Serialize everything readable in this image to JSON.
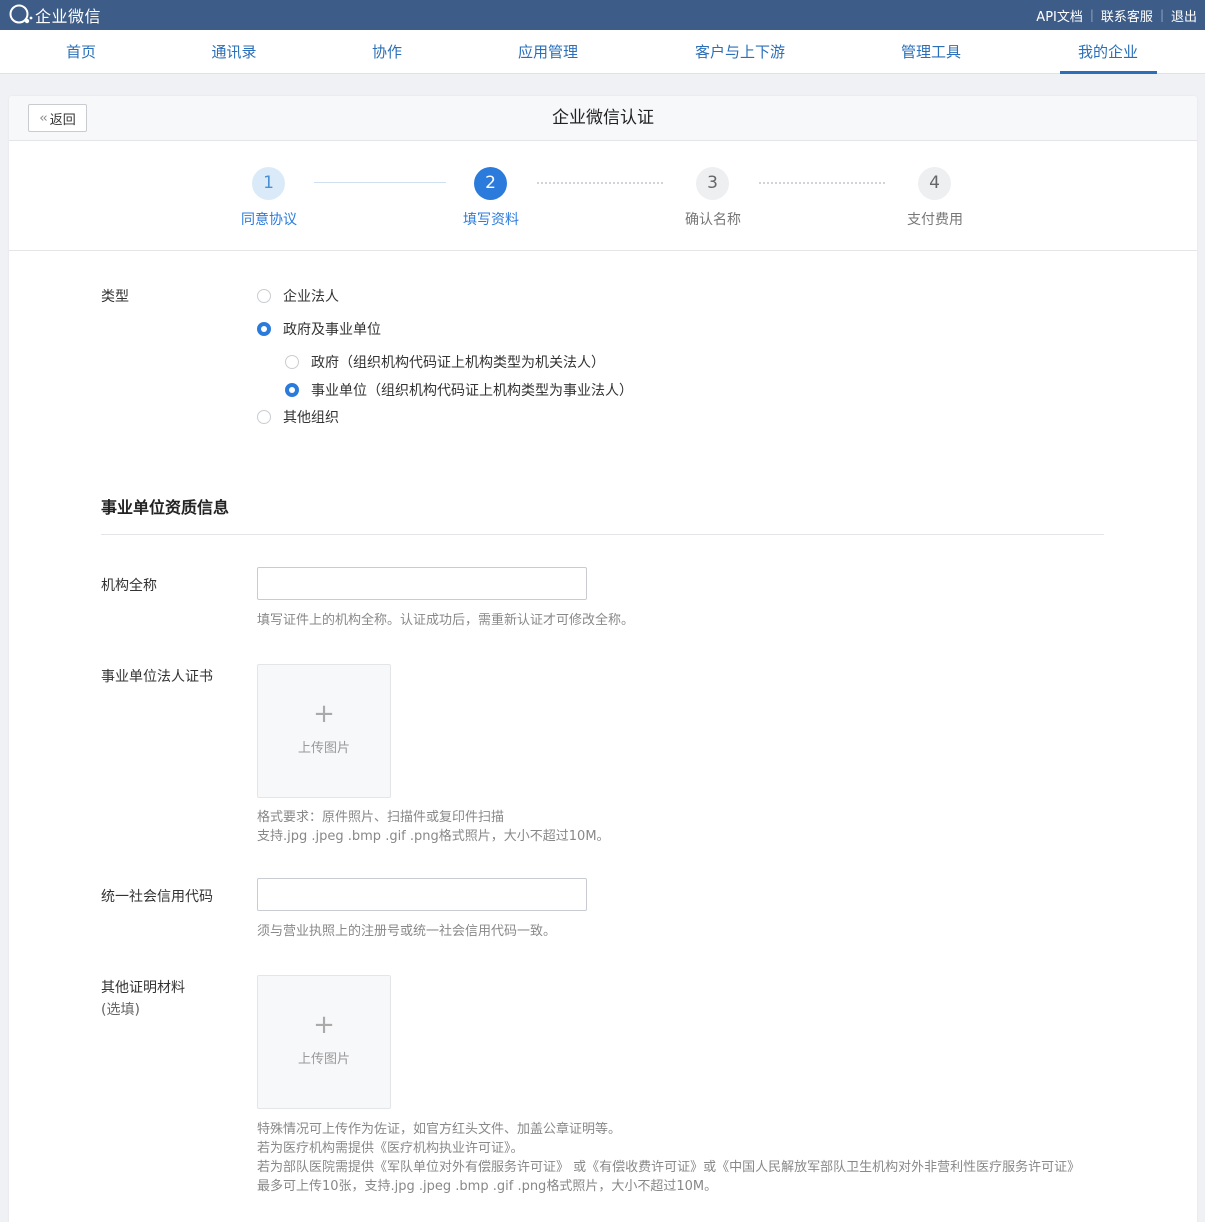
{
  "topbar": {
    "logo_text": "企业微信",
    "links": [
      "API文档",
      "联系客服",
      "退出"
    ]
  },
  "nav": {
    "items": [
      "首页",
      "通讯录",
      "协作",
      "应用管理",
      "客户与上下游",
      "管理工具",
      "我的企业"
    ],
    "active_index": 6
  },
  "panel": {
    "back_label": "返回",
    "title": "企业微信认证"
  },
  "steps": [
    {
      "num": "1",
      "label": "同意协议",
      "state": "done"
    },
    {
      "num": "2",
      "label": "填写资料",
      "state": "current"
    },
    {
      "num": "3",
      "label": "确认名称",
      "state": "todo"
    },
    {
      "num": "4",
      "label": "支付费用",
      "state": "todo"
    }
  ],
  "type_section": {
    "label": "类型",
    "options": [
      {
        "label": "企业法人",
        "selected": false
      },
      {
        "label": "政府及事业单位",
        "selected": true
      },
      {
        "label": "其他组织",
        "selected": false
      }
    ],
    "sub_options": [
      {
        "label": "政府（组织机构代码证上机构类型为机关法人）",
        "selected": false
      },
      {
        "label": "事业单位（组织机构代码证上机构类型为事业法人）",
        "selected": true
      }
    ]
  },
  "qualification": {
    "title": "事业单位资质信息",
    "org_name": {
      "label": "机构全称",
      "value": "",
      "hint": "填写证件上的机构全称。认证成功后，需重新认证才可修改全称。"
    },
    "certificate": {
      "label": "事业单位法人证书",
      "upload_label": "上传图片",
      "hints": [
        "格式要求：原件照片、扫描件或复印件扫描",
        "支持.jpg .jpeg .bmp .gif .png格式照片，大小不超过10M。"
      ]
    },
    "credit_code": {
      "label": "统一社会信用代码",
      "value": "",
      "hint": "须与营业执照上的注册号或统一社会信用代码一致。"
    },
    "other_materials": {
      "label": "其他证明材料",
      "sublabel": "(选填)",
      "upload_label": "上传图片",
      "hints": [
        "特殊情况可上传作为佐证，如官方红头文件、加盖公章证明等。",
        "若为医疗机构需提供《医疗机构执业许可证》。",
        "若为部队医院需提供《军队单位对外有偿服务许可证》 或《有偿收费许可证》或《中国人民解放军部队卫生机构对外非营利性医疗服务许可证》",
        "最多可上传10张，支持.jpg .jpeg .bmp .gif .png格式照片，大小不超过10M。"
      ]
    }
  }
}
